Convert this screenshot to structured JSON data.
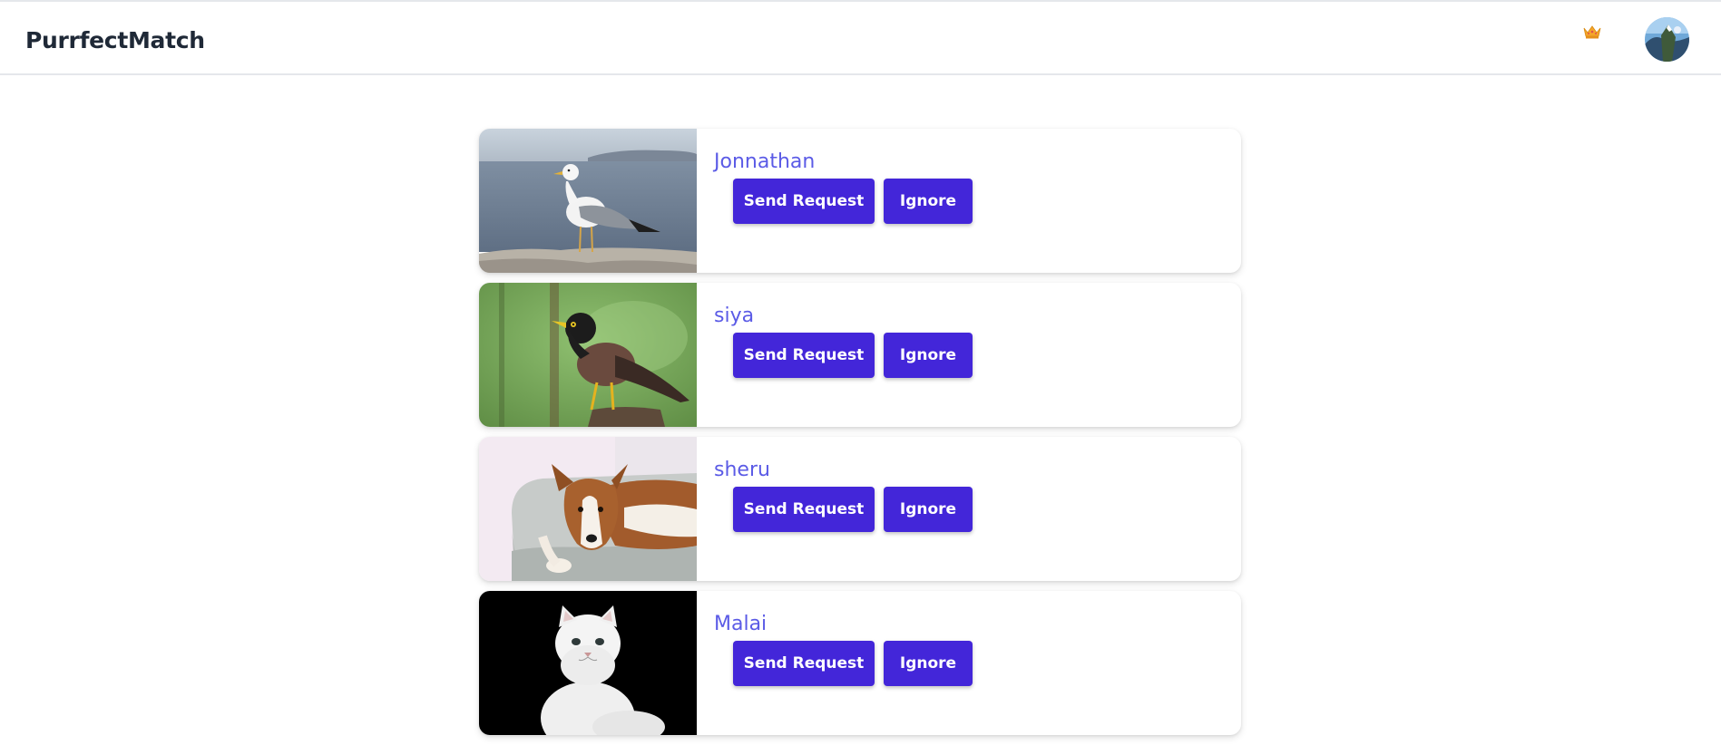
{
  "header": {
    "brand": "PurrfectMatch",
    "crown_icon": "crown-icon",
    "avatar_icon": "user-avatar"
  },
  "theme": {
    "accent": "#4326d9",
    "name_color": "#5b5be6"
  },
  "feed": {
    "cards": [
      {
        "name": "Jonnathan",
        "image": "seagull-photo",
        "send_label": "Send Request",
        "ignore_label": "Ignore"
      },
      {
        "name": "siya",
        "image": "myna-bird-photo",
        "send_label": "Send Request",
        "ignore_label": "Ignore"
      },
      {
        "name": "sheru",
        "image": "collie-dog-photo",
        "send_label": "Send Request",
        "ignore_label": "Ignore"
      },
      {
        "name": "Malai",
        "image": "persian-cat-photo",
        "send_label": "Send Request",
        "ignore_label": "Ignore"
      }
    ]
  }
}
